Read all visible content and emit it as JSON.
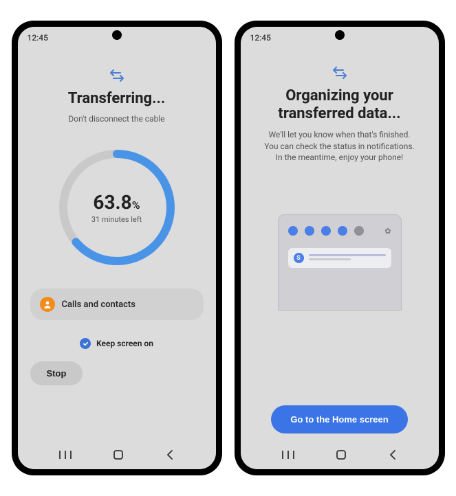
{
  "status_time": "12:45",
  "left": {
    "title": "Transferring...",
    "subtitle": "Don't disconnect the cable",
    "progress_pct": 63.8,
    "progress_pct_label": "63.8",
    "progress_unit": "%",
    "time_left": "31 minutes left",
    "item_label": "Calls and contacts",
    "keep_screen_label": "Keep screen on",
    "keep_screen_checked": true,
    "stop_label": "Stop"
  },
  "right": {
    "title": "Organizing your transferred data...",
    "line1": "We'll let you know when that's finished.",
    "line2": "You can check the status in notifications.",
    "line3": "In the meantime, enjoy your phone!",
    "primary_button": "Go to the Home screen"
  },
  "colors": {
    "accent": "#3b74e6",
    "ring": "#4a94e8",
    "orange": "#f28c1c"
  }
}
